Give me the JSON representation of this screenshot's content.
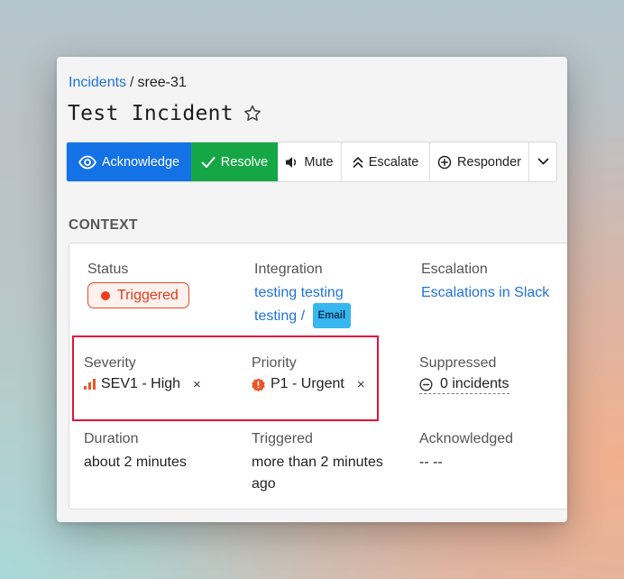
{
  "breadcrumb": {
    "parent": "Incidents",
    "separator": "/",
    "current": "sree-31"
  },
  "incident": {
    "title": "Test Incident"
  },
  "toolbar": {
    "acknowledge": "Acknowledge",
    "resolve": "Resolve",
    "mute": "Mute",
    "escalate": "Escalate",
    "responder": "Responder"
  },
  "context": {
    "section_label": "CONTEXT",
    "status": {
      "label": "Status",
      "value": "Triggered"
    },
    "integration": {
      "label": "Integration",
      "line1": "testing testing",
      "line2": "testing",
      "separator": "/",
      "tag": "Email"
    },
    "escalation": {
      "label": "Escalation",
      "value": "Escalations in Slack"
    },
    "severity": {
      "label": "Severity",
      "value": "SEV1 - High",
      "remove": "×"
    },
    "priority": {
      "label": "Priority",
      "value": "P1 - Urgent",
      "remove": "×"
    },
    "suppressed": {
      "label": "Suppressed",
      "value": "0 incidents"
    },
    "duration": {
      "label": "Duration",
      "value": "about 2 minutes"
    },
    "triggered": {
      "label": "Triggered",
      "line1": "more than 2 minutes",
      "line2": "ago"
    },
    "acknowledged": {
      "label": "Acknowledged",
      "value": "-- --"
    }
  },
  "colors": {
    "primary": "#1272e6",
    "success": "#15a745",
    "triggered": "#e23c1c",
    "link": "#1f73d9",
    "highlight": "#e0143a",
    "email_tag": "#37b6f0"
  }
}
